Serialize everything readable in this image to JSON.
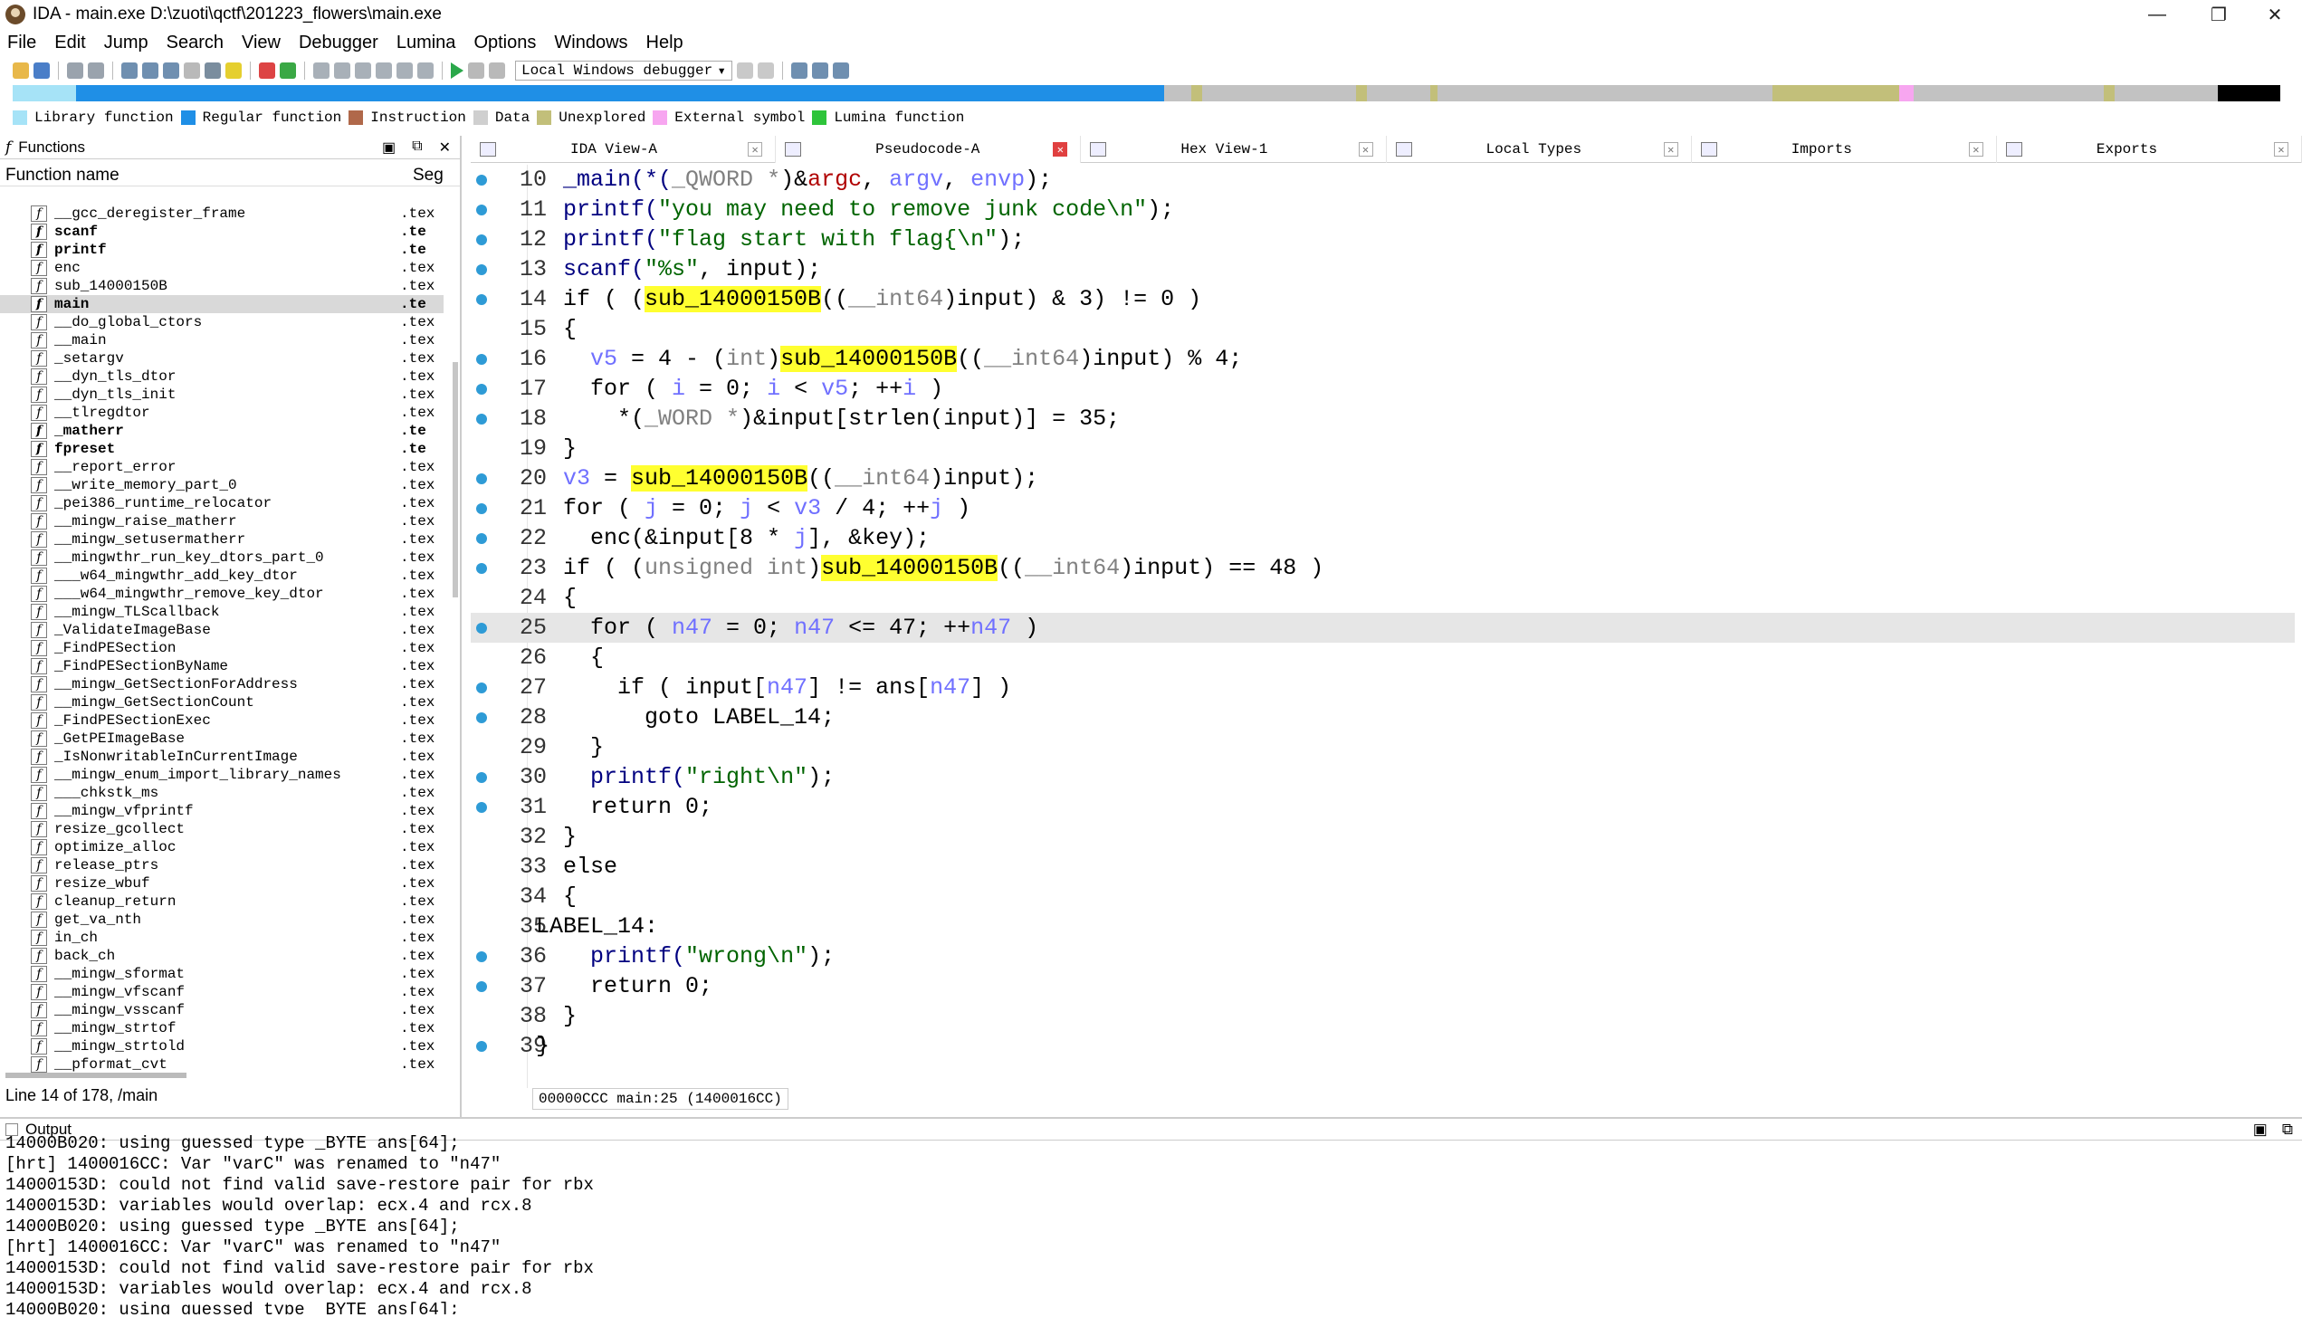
{
  "window": {
    "title": "IDA - main.exe D:\\zuoti\\qctf\\201223_flowers\\main.exe"
  },
  "menu": [
    "File",
    "Edit",
    "Jump",
    "Search",
    "View",
    "Debugger",
    "Lumina",
    "Options",
    "Windows",
    "Help"
  ],
  "toolbar": {
    "debugger": "Local Windows debugger"
  },
  "legend": [
    {
      "label": "Library function",
      "color": "#a6e3f7"
    },
    {
      "label": "Regular function",
      "color": "#1f8fe6"
    },
    {
      "label": "Instruction",
      "color": "#b0684a"
    },
    {
      "label": "Data",
      "color": "#cfcfcf"
    },
    {
      "label": "Unexplored",
      "color": "#c2bf7a"
    },
    {
      "label": "External symbol",
      "color": "#f7a6f0"
    },
    {
      "label": "Lumina function",
      "color": "#2ec43a"
    }
  ],
  "functions_panel": {
    "title": "Functions",
    "col_name": "Function name",
    "col_seg": "Seg",
    "status": "Line 14 of 178, /main",
    "items": [
      {
        "name": "__gcc_deregister_frame",
        "seg": ".tex",
        "bold": false,
        "selected": false
      },
      {
        "name": "scanf",
        "seg": ".te",
        "bold": true,
        "selected": false
      },
      {
        "name": "printf",
        "seg": ".te",
        "bold": true,
        "selected": false
      },
      {
        "name": "enc",
        "seg": ".tex",
        "bold": false,
        "selected": false
      },
      {
        "name": "sub_14000150B",
        "seg": ".tex",
        "bold": false,
        "selected": false
      },
      {
        "name": "main",
        "seg": ".te",
        "bold": true,
        "selected": true
      },
      {
        "name": "__do_global_ctors",
        "seg": ".tex",
        "bold": false,
        "selected": false
      },
      {
        "name": "__main",
        "seg": ".tex",
        "bold": false,
        "selected": false
      },
      {
        "name": "_setargv",
        "seg": ".tex",
        "bold": false,
        "selected": false
      },
      {
        "name": "__dyn_tls_dtor",
        "seg": ".tex",
        "bold": false,
        "selected": false
      },
      {
        "name": "__dyn_tls_init",
        "seg": ".tex",
        "bold": false,
        "selected": false
      },
      {
        "name": "__tlregdtor",
        "seg": ".tex",
        "bold": false,
        "selected": false
      },
      {
        "name": "_matherr",
        "seg": ".te",
        "bold": true,
        "selected": false
      },
      {
        "name": "fpreset",
        "seg": ".te",
        "bold": true,
        "selected": false
      },
      {
        "name": "__report_error",
        "seg": ".tex",
        "bold": false,
        "selected": false
      },
      {
        "name": "__write_memory_part_0",
        "seg": ".tex",
        "bold": false,
        "selected": false
      },
      {
        "name": "_pei386_runtime_relocator",
        "seg": ".tex",
        "bold": false,
        "selected": false
      },
      {
        "name": "__mingw_raise_matherr",
        "seg": ".tex",
        "bold": false,
        "selected": false
      },
      {
        "name": "__mingw_setusermatherr",
        "seg": ".tex",
        "bold": false,
        "selected": false
      },
      {
        "name": "__mingwthr_run_key_dtors_part_0",
        "seg": ".tex",
        "bold": false,
        "selected": false
      },
      {
        "name": "___w64_mingwthr_add_key_dtor",
        "seg": ".tex",
        "bold": false,
        "selected": false
      },
      {
        "name": "___w64_mingwthr_remove_key_dtor",
        "seg": ".tex",
        "bold": false,
        "selected": false
      },
      {
        "name": "__mingw_TLScallback",
        "seg": ".tex",
        "bold": false,
        "selected": false
      },
      {
        "name": "_ValidateImageBase",
        "seg": ".tex",
        "bold": false,
        "selected": false
      },
      {
        "name": "_FindPESection",
        "seg": ".tex",
        "bold": false,
        "selected": false
      },
      {
        "name": "_FindPESectionByName",
        "seg": ".tex",
        "bold": false,
        "selected": false
      },
      {
        "name": "__mingw_GetSectionForAddress",
        "seg": ".tex",
        "bold": false,
        "selected": false
      },
      {
        "name": "__mingw_GetSectionCount",
        "seg": ".tex",
        "bold": false,
        "selected": false
      },
      {
        "name": "_FindPESectionExec",
        "seg": ".tex",
        "bold": false,
        "selected": false
      },
      {
        "name": "_GetPEImageBase",
        "seg": ".tex",
        "bold": false,
        "selected": false
      },
      {
        "name": "_IsNonwritableInCurrentImage",
        "seg": ".tex",
        "bold": false,
        "selected": false
      },
      {
        "name": "__mingw_enum_import_library_names",
        "seg": ".tex",
        "bold": false,
        "selected": false
      },
      {
        "name": "___chkstk_ms",
        "seg": ".tex",
        "bold": false,
        "selected": false
      },
      {
        "name": "__mingw_vfprintf",
        "seg": ".tex",
        "bold": false,
        "selected": false
      },
      {
        "name": "resize_gcollect",
        "seg": ".tex",
        "bold": false,
        "selected": false
      },
      {
        "name": "optimize_alloc",
        "seg": ".tex",
        "bold": false,
        "selected": false
      },
      {
        "name": "release_ptrs",
        "seg": ".tex",
        "bold": false,
        "selected": false
      },
      {
        "name": "resize_wbuf",
        "seg": ".tex",
        "bold": false,
        "selected": false
      },
      {
        "name": "cleanup_return",
        "seg": ".tex",
        "bold": false,
        "selected": false
      },
      {
        "name": "get_va_nth",
        "seg": ".tex",
        "bold": false,
        "selected": false
      },
      {
        "name": "in_ch",
        "seg": ".tex",
        "bold": false,
        "selected": false
      },
      {
        "name": "back_ch",
        "seg": ".tex",
        "bold": false,
        "selected": false
      },
      {
        "name": "__mingw_sformat",
        "seg": ".tex",
        "bold": false,
        "selected": false
      },
      {
        "name": "__mingw_vfscanf",
        "seg": ".tex",
        "bold": false,
        "selected": false
      },
      {
        "name": "__mingw_vsscanf",
        "seg": ".tex",
        "bold": false,
        "selected": false
      },
      {
        "name": "__mingw_strtof",
        "seg": ".tex",
        "bold": false,
        "selected": false
      },
      {
        "name": "__mingw_strtold",
        "seg": ".tex",
        "bold": false,
        "selected": false
      },
      {
        "name": "__pformat_cvt",
        "seg": ".tex",
        "bold": false,
        "selected": false
      }
    ]
  },
  "tabs": [
    {
      "label": "IDA View-A",
      "active": false
    },
    {
      "label": "Pseudocode-A",
      "active": true
    },
    {
      "label": "Hex View-1",
      "active": false
    },
    {
      "label": "Local Types",
      "active": false
    },
    {
      "label": "Imports",
      "active": false
    },
    {
      "label": "Exports",
      "active": false
    }
  ],
  "code": {
    "status": "00000CCC main:25 (1400016CC)",
    "lines": [
      {
        "n": "10",
        "dot": true,
        "cur": false,
        "indent": "  ",
        "tokens": [
          [
            "_main(*(",
            "fn"
          ],
          [
            "_QWORD *",
            "gray"
          ],
          [
            ")&",
            ""
          ],
          [
            "argc",
            "red"
          ],
          [
            ", ",
            ""
          ],
          [
            "argv",
            "var"
          ],
          [
            ", ",
            ""
          ],
          [
            "envp",
            "var"
          ],
          [
            ");",
            ""
          ]
        ]
      },
      {
        "n": "11",
        "dot": true,
        "cur": false,
        "indent": "  ",
        "tokens": [
          [
            "printf(",
            "fn"
          ],
          [
            "\"you may need to remove junk code\\n\"",
            "str"
          ],
          [
            ");",
            ""
          ]
        ]
      },
      {
        "n": "12",
        "dot": true,
        "cur": false,
        "indent": "  ",
        "tokens": [
          [
            "printf(",
            "fn"
          ],
          [
            "\"flag start with flag{\\n\"",
            "str"
          ],
          [
            ");",
            ""
          ]
        ]
      },
      {
        "n": "13",
        "dot": true,
        "cur": false,
        "indent": "  ",
        "tokens": [
          [
            "scanf(",
            "fn"
          ],
          [
            "\"%s\"",
            "str"
          ],
          [
            ", input);",
            ""
          ]
        ]
      },
      {
        "n": "14",
        "dot": true,
        "cur": false,
        "indent": "  ",
        "tokens": [
          [
            "if ( (",
            ""
          ],
          [
            "sub_14000150B",
            "hl"
          ],
          [
            "((",
            ""
          ],
          [
            "__int64",
            "gray"
          ],
          [
            ")input) & 3) != 0 )",
            ""
          ]
        ]
      },
      {
        "n": "15",
        "dot": false,
        "cur": false,
        "indent": "  ",
        "tokens": [
          [
            "{",
            ""
          ]
        ]
      },
      {
        "n": "16",
        "dot": true,
        "cur": false,
        "indent": "    ",
        "tokens": [
          [
            "v5",
            "var"
          ],
          [
            " = 4 - (",
            ""
          ],
          [
            "int",
            "gray"
          ],
          [
            ")",
            ""
          ],
          [
            "sub_14000150B",
            "hl"
          ],
          [
            "((",
            ""
          ],
          [
            "__int64",
            "gray"
          ],
          [
            ")input) % 4;",
            ""
          ]
        ]
      },
      {
        "n": "17",
        "dot": true,
        "cur": false,
        "indent": "    ",
        "tokens": [
          [
            "for ( ",
            ""
          ],
          [
            "i",
            "var"
          ],
          [
            " = 0; ",
            ""
          ],
          [
            "i",
            "var"
          ],
          [
            " < ",
            ""
          ],
          [
            "v5",
            "var"
          ],
          [
            "; ++",
            ""
          ],
          [
            "i",
            "var"
          ],
          [
            " )",
            ""
          ]
        ]
      },
      {
        "n": "18",
        "dot": true,
        "cur": false,
        "indent": "      ",
        "tokens": [
          [
            "*(",
            ""
          ],
          [
            "_WORD *",
            "gray"
          ],
          [
            ")&input[strlen(input)] = 35;",
            ""
          ]
        ]
      },
      {
        "n": "19",
        "dot": false,
        "cur": false,
        "indent": "  ",
        "tokens": [
          [
            "}",
            ""
          ]
        ]
      },
      {
        "n": "20",
        "dot": true,
        "cur": false,
        "indent": "  ",
        "tokens": [
          [
            "v3",
            "var"
          ],
          [
            " = ",
            ""
          ],
          [
            "sub_14000150B",
            "hl"
          ],
          [
            "((",
            ""
          ],
          [
            "__int64",
            "gray"
          ],
          [
            ")input);",
            ""
          ]
        ]
      },
      {
        "n": "21",
        "dot": true,
        "cur": false,
        "indent": "  ",
        "tokens": [
          [
            "for ( ",
            ""
          ],
          [
            "j",
            "var"
          ],
          [
            " = 0; ",
            ""
          ],
          [
            "j",
            "var"
          ],
          [
            " < ",
            ""
          ],
          [
            "v3",
            "var"
          ],
          [
            " / 4; ++",
            ""
          ],
          [
            "j",
            "var"
          ],
          [
            " )",
            ""
          ]
        ]
      },
      {
        "n": "22",
        "dot": true,
        "cur": false,
        "indent": "    ",
        "tokens": [
          [
            "enc(&input[8 * ",
            ""
          ],
          [
            "j",
            "var"
          ],
          [
            "], &key);",
            ""
          ]
        ]
      },
      {
        "n": "23",
        "dot": true,
        "cur": false,
        "indent": "  ",
        "tokens": [
          [
            "if ( (",
            ""
          ],
          [
            "unsigned int",
            "gray"
          ],
          [
            ")",
            ""
          ],
          [
            "sub_14000150B",
            "hl"
          ],
          [
            "((",
            ""
          ],
          [
            "__int64",
            "gray"
          ],
          [
            ")input) == 48 )",
            ""
          ]
        ]
      },
      {
        "n": "24",
        "dot": false,
        "cur": false,
        "indent": "  ",
        "tokens": [
          [
            "{",
            ""
          ]
        ]
      },
      {
        "n": "25",
        "dot": true,
        "cur": true,
        "indent": "    ",
        "tokens": [
          [
            "for ( ",
            ""
          ],
          [
            "n47",
            "var"
          ],
          [
            " = 0; ",
            ""
          ],
          [
            "n47",
            "var"
          ],
          [
            " <= 47; ++",
            ""
          ],
          [
            "n47",
            "var"
          ],
          [
            " )",
            ""
          ]
        ]
      },
      {
        "n": "26",
        "dot": false,
        "cur": false,
        "indent": "    ",
        "tokens": [
          [
            "{",
            ""
          ]
        ]
      },
      {
        "n": "27",
        "dot": true,
        "cur": false,
        "indent": "      ",
        "tokens": [
          [
            "if ( input[",
            ""
          ],
          [
            "n47",
            "var"
          ],
          [
            "] != ans[",
            ""
          ],
          [
            "n47",
            "var"
          ],
          [
            "] )",
            ""
          ]
        ]
      },
      {
        "n": "28",
        "dot": true,
        "cur": false,
        "indent": "        ",
        "tokens": [
          [
            "goto LABEL_14;",
            ""
          ]
        ]
      },
      {
        "n": "29",
        "dot": false,
        "cur": false,
        "indent": "    ",
        "tokens": [
          [
            "}",
            ""
          ]
        ]
      },
      {
        "n": "30",
        "dot": true,
        "cur": false,
        "indent": "    ",
        "tokens": [
          [
            "printf(",
            "fn"
          ],
          [
            "\"right\\n\"",
            "str"
          ],
          [
            ");",
            ""
          ]
        ]
      },
      {
        "n": "31",
        "dot": true,
        "cur": false,
        "indent": "    ",
        "tokens": [
          [
            "return 0;",
            ""
          ]
        ]
      },
      {
        "n": "32",
        "dot": false,
        "cur": false,
        "indent": "  ",
        "tokens": [
          [
            "}",
            ""
          ]
        ]
      },
      {
        "n": "33",
        "dot": false,
        "cur": false,
        "indent": "  ",
        "tokens": [
          [
            "else",
            ""
          ]
        ]
      },
      {
        "n": "34",
        "dot": false,
        "cur": false,
        "indent": "  ",
        "tokens": [
          [
            "{",
            ""
          ]
        ]
      },
      {
        "n": "35",
        "dot": false,
        "cur": false,
        "indent": "",
        "tokens": [
          [
            "LABEL_14:",
            ""
          ]
        ]
      },
      {
        "n": "36",
        "dot": true,
        "cur": false,
        "indent": "    ",
        "tokens": [
          [
            "printf(",
            "fn"
          ],
          [
            "\"wrong\\n\"",
            "str"
          ],
          [
            ");",
            ""
          ]
        ]
      },
      {
        "n": "37",
        "dot": true,
        "cur": false,
        "indent": "    ",
        "tokens": [
          [
            "return 0;",
            ""
          ]
        ]
      },
      {
        "n": "38",
        "dot": false,
        "cur": false,
        "indent": "  ",
        "tokens": [
          [
            "}",
            ""
          ]
        ]
      },
      {
        "n": "39",
        "dot": true,
        "cur": false,
        "indent": "",
        "tokens": [
          [
            "}",
            ""
          ]
        ]
      }
    ]
  },
  "output": {
    "title": "Output",
    "lines": [
      "14000B020: using guessed type _BYTE ans[64];",
      "[hrt] 1400016CC: Var \"varC\" was renamed to \"n47\"",
      "14000153D: could not find valid save-restore pair for rbx",
      "14000153D: variables would overlap: ecx.4 and rcx.8",
      "14000B020: using guessed type _BYTE ans[64];",
      "[hrt] 1400016CC: Var \"varC\" was renamed to \"n47\"",
      "14000153D: could not find valid save-restore pair for rbx",
      "14000153D: variables would overlap: ecx.4 and rcx.8",
      "14000B020: using guessed type _BYTE ans[64];"
    ]
  }
}
